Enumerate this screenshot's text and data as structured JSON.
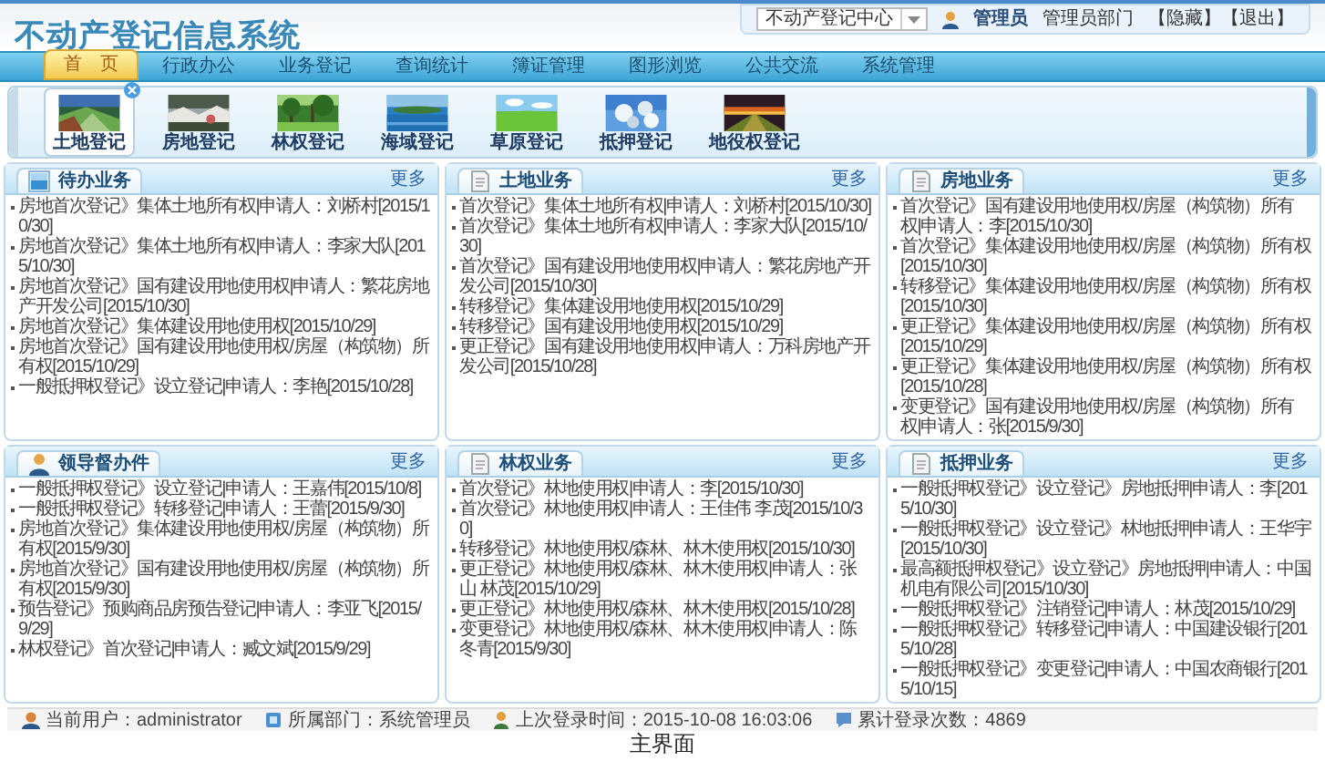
{
  "app_title": "不动产登记信息系统",
  "header": {
    "center_select": "不动产登记中心",
    "user": "管理员",
    "department": "管理员部门",
    "links": [
      "【隐藏】",
      "【退出】"
    ]
  },
  "nav": [
    {
      "label": "首　页",
      "selected": true
    },
    {
      "label": "行政办公",
      "selected": false
    },
    {
      "label": "业务登记",
      "selected": false
    },
    {
      "label": "查询统计",
      "selected": false
    },
    {
      "label": "簿证管理",
      "selected": false
    },
    {
      "label": "图形浏览",
      "selected": false
    },
    {
      "label": "公共交流",
      "selected": false
    },
    {
      "label": "系统管理",
      "selected": false
    }
  ],
  "shortcuts": [
    {
      "label": "土地登记",
      "selected": true,
      "kind": "picture"
    },
    {
      "label": "房地登记",
      "selected": false,
      "kind": "picture"
    },
    {
      "label": "林权登记",
      "selected": false,
      "kind": "picture"
    },
    {
      "label": "海域登记",
      "selected": false,
      "kind": "picture"
    },
    {
      "label": "草原登记",
      "selected": false,
      "kind": "picture"
    },
    {
      "label": "抵押登记",
      "selected": false,
      "kind": "picture"
    },
    {
      "label": "地役权登记",
      "selected": false,
      "kind": "picture"
    }
  ],
  "panels": [
    {
      "title": "待办业务",
      "more": "更多",
      "items": [
        "房地首次登记》集体土地所有权|申请人：刘桥村[2015/10/30]",
        "房地首次登记》集体土地所有权|申请人：李家大队[2015/10/30]",
        "房地首次登记》国有建设用地使用权|申请人：繁花房地产开发公司[2015/10/30]",
        "房地首次登记》集体建设用地使用权[2015/10/29]",
        "房地首次登记》国有建设用地使用权/房屋（构筑物）所有权[2015/10/29]",
        "一般抵押权登记》设立登记|申请人：李艳[2015/10/28]"
      ]
    },
    {
      "title": "土地业务",
      "more": "更多",
      "items": [
        "首次登记》集体土地所有权|申请人：刘桥村[2015/10/30]",
        "首次登记》集体土地所有权|申请人：李家大队[2015/10/30]",
        "首次登记》国有建设用地使用权|申请人：繁花房地产开发公司[2015/10/30]",
        "转移登记》集体建设用地使用权[2015/10/29]",
        "转移登记》国有建设用地使用权[2015/10/29]",
        "更正登记》国有建设用地使用权|申请人：万科房地产开发公司[2015/10/28]"
      ]
    },
    {
      "title": "房地业务",
      "more": "更多",
      "items": [
        "首次登记》国有建设用地使用权/房屋（构筑物）所有权|申请人：李[2015/10/30]",
        "首次登记》集体建设用地使用权/房屋（构筑物）所有权[2015/10/30]",
        "转移登记》集体建设用地使用权/房屋（构筑物）所有权[2015/10/30]",
        "更正登记》集体建设用地使用权/房屋（构筑物）所有权[2015/10/29]",
        "更正登记》集体建设用地使用权/房屋（构筑物）所有权[2015/10/28]",
        "变更登记》国有建设用地使用权/房屋（构筑物）所有权|申请人：张[2015/9/30]"
      ]
    },
    {
      "title": "领导督办件",
      "more": "更多",
      "items": [
        "一般抵押权登记》设立登记|申请人：王嘉伟[2015/10/8]",
        "一般抵押权登记》转移登记|申请人：王蕾[2015/9/30]",
        "房地首次登记》集体建设用地使用权/房屋（构筑物）所有权[2015/9/30]",
        "房地首次登记》国有建设用地使用权/房屋（构筑物）所有权[2015/9/30]",
        "预告登记》预购商品房预告登记|申请人：李亚飞[2015/9/29]",
        "林权登记》首次登记|申请人：臧文斌[2015/9/29]"
      ]
    },
    {
      "title": "林权业务",
      "more": "更多",
      "items": [
        "首次登记》林地使用权|申请人：李[2015/10/30]",
        "首次登记》林地使用权|申请人：王佳伟 李茂[2015/10/30]",
        "转移登记》林地使用权/森林、林木使用权[2015/10/30]",
        "更正登记》林地使用权/森林、林木使用权|申请人：张山 林茂[2015/10/29]",
        "更正登记》林地使用权/森林、林木使用权[2015/10/28]",
        "变更登记》林地使用权/森林、林木使用权|申请人：陈冬青[2015/9/30]"
      ]
    },
    {
      "title": "抵押业务",
      "more": "更多",
      "items": [
        "一般抵押权登记》设立登记》房地抵押|申请人：李[2015/10/30]",
        "一般抵押权登记》设立登记》林地抵押|申请人：王华宇[2015/10/30]",
        "最高额抵押权登记》设立登记》房地抵押|申请人：中国机电有限公司[2015/10/30]",
        "一般抵押权登记》注销登记|申请人：林茂[2015/10/29]",
        "一般抵押权登记》转移登记|申请人：中国建设银行[2015/10/28]",
        "一般抵押权登记》变更登记|申请人：中国农商银行[2015/10/15]"
      ]
    }
  ],
  "status_bar": [
    "当前用户：administrator",
    "所属部门：系统管理员",
    "上次登录时间：2015-10-08 16:03:06",
    "累计登录次数：4869"
  ],
  "caption": "主界面"
}
